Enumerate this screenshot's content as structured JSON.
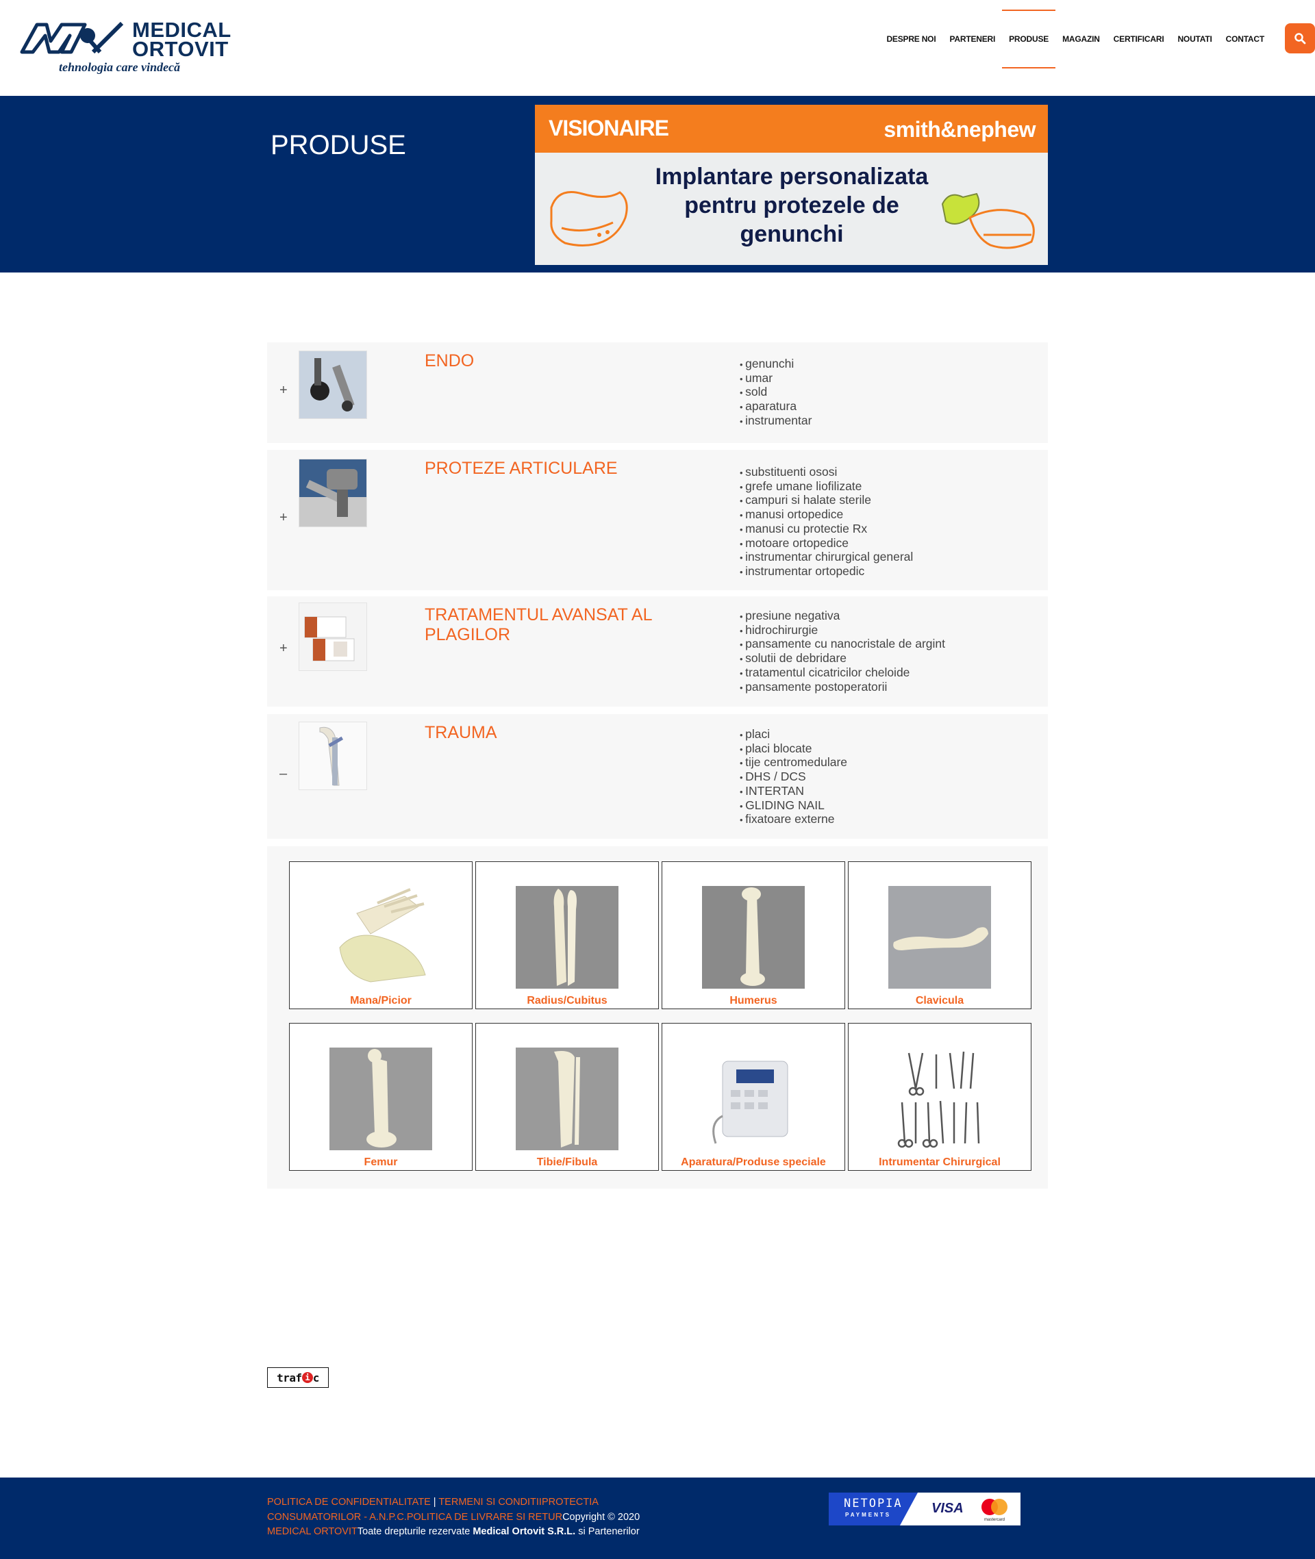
{
  "header": {
    "brand_line1": "MEDICAL",
    "brand_line2": "ORTOVIT",
    "tagline": "tehnologia care vindecă",
    "nav": [
      {
        "label": "DESPRE NOI"
      },
      {
        "label": "PARTENERI"
      },
      {
        "label": "PRODUSE",
        "active": true
      },
      {
        "label": "MAGAZIN"
      },
      {
        "label": "CERTIFICARI"
      },
      {
        "label": "NOUTATI"
      },
      {
        "label": "CONTACT"
      }
    ],
    "search_icon": "search-icon"
  },
  "hero": {
    "title": "PRODUSE",
    "banner": {
      "brand_left": "VISIONAIRE",
      "brand_right": "smith&nephew",
      "headline": "Implantare personalizata pentru protezele de genunchi"
    }
  },
  "categories": [
    {
      "toggle": "+",
      "title": "ENDO",
      "items": [
        "genunchi",
        "umar",
        "sold",
        "aparatura",
        "instrumentar"
      ]
    },
    {
      "toggle": "+",
      "title": "PROTEZE ARTICULARE",
      "items": [
        "substituenti ososi",
        "grefe umane liofilizate",
        "campuri si halate sterile",
        "manusi ortopedice",
        "manusi cu protectie Rx",
        "motoare ortopedice",
        "instrumentar chirurgical general",
        "instrumentar ortopedic"
      ]
    },
    {
      "toggle": "+",
      "title": "TRATAMENTUL AVANSAT AL PLAGILOR",
      "items": [
        "presiune negativa",
        "hidrochirurgie",
        "pansamente cu nanocristale de argint",
        "solutii de debridare",
        "tratamentul cicatricilor cheloide",
        "pansamente postoperatorii"
      ]
    },
    {
      "toggle": "–",
      "title": "TRAUMA",
      "items": [
        "placi",
        "placi blocate",
        "tije centromedulare",
        "DHS / DCS",
        "INTERTAN",
        "GLIDING NAIL",
        "fixatoare externe"
      ]
    }
  ],
  "gallery": [
    {
      "caption": "Mana/Picior"
    },
    {
      "caption": "Radius/Cubitus"
    },
    {
      "caption": "Humerus"
    },
    {
      "caption": "Clavicula"
    },
    {
      "caption": "Femur"
    },
    {
      "caption": "Tibie/Fibula"
    },
    {
      "caption": "Aparatura/Produse speciale"
    },
    {
      "caption": "Intrumentar Chirurgical"
    }
  ],
  "trafic": {
    "pre": "traf",
    "i": "i",
    "post": "c"
  },
  "footer": {
    "link_privacy": "POLITICA DE CONFIDENTIALITATE",
    "sep": " | ",
    "link_terms": "TERMENI SI CONDITII",
    "link_anpc": "PROTECTIA CONSUMATORILOR - A.N.P.C.",
    "link_delivery": "POLITICA DE LIVRARE SI RETUR",
    "copyright": "Copyright © 2020",
    "brand": "MEDICAL ORTOVIT",
    "rights": "Toate drepturile rezervate ",
    "company": "Medical Ortovit S.R.L.",
    "rights_tail": " si Partenerilor",
    "payments": {
      "netopia": "NETOPIA",
      "netopia_sub": "PAYMENTS",
      "visa": "VISA",
      "mastercard": "mastercard"
    }
  }
}
